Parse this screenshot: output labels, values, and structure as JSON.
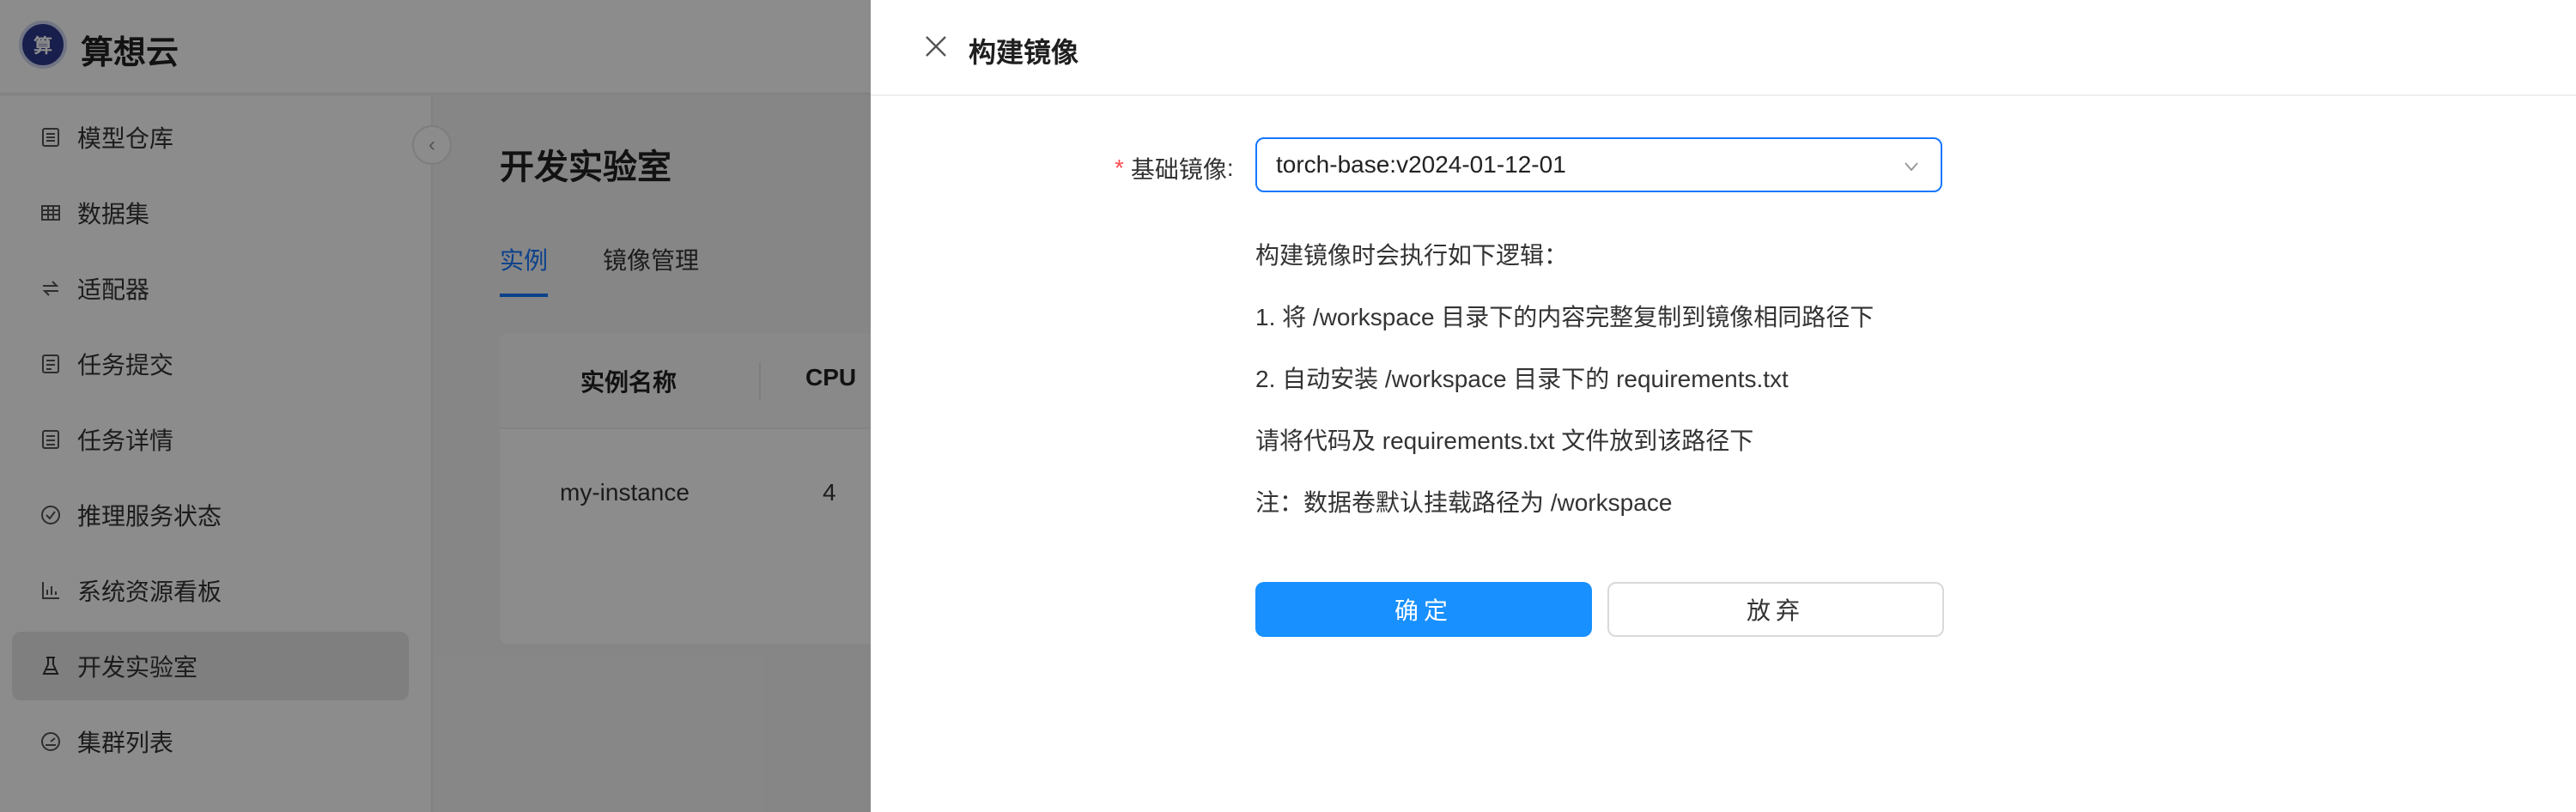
{
  "app": {
    "brand": "算想云",
    "logo_text": "算"
  },
  "sidebar": {
    "items": [
      {
        "label": "模型仓库",
        "icon": "archive-icon"
      },
      {
        "label": "数据集",
        "icon": "table-icon"
      },
      {
        "label": "适配器",
        "icon": "swap-icon"
      },
      {
        "label": "任务提交",
        "icon": "form-icon"
      },
      {
        "label": "任务详情",
        "icon": "list-icon"
      },
      {
        "label": "推理服务状态",
        "icon": "check-circle-icon"
      },
      {
        "label": "系统资源看板",
        "icon": "bar-chart-icon"
      },
      {
        "label": "开发实验室",
        "icon": "flask-icon",
        "active": true
      },
      {
        "label": "集群列表",
        "icon": "dashboard-icon"
      }
    ]
  },
  "main": {
    "title": "开发实验室",
    "tabs": [
      {
        "label": "实例",
        "active": true
      },
      {
        "label": "镜像管理"
      }
    ],
    "table": {
      "columns": [
        "实例名称",
        "CPU"
      ],
      "rows": [
        [
          "my-instance",
          "4"
        ]
      ]
    }
  },
  "drawer": {
    "title": "构建镜像",
    "form": {
      "label": "基础镜像",
      "colon": ":",
      "required_mark": "*",
      "value": "torch-base:v2024-01-12-01"
    },
    "description": [
      "构建镜像时会执行如下逻辑：",
      "1. 将 /workspace 目录下的内容完整复制到镜像相同路径下",
      "2. 自动安装 /workspace 目录下的 requirements.txt",
      "请将代码及 requirements.txt 文件放到该路径下",
      "注：数据卷默认挂载路径为 /workspace"
    ],
    "confirm_label": "确定",
    "cancel_label": "放弃"
  },
  "colors": {
    "primary": "#1890ff",
    "focus_border": "#1677ff",
    "required": "#ff4d4f",
    "mask": "rgba(0,0,0,0.45)"
  }
}
